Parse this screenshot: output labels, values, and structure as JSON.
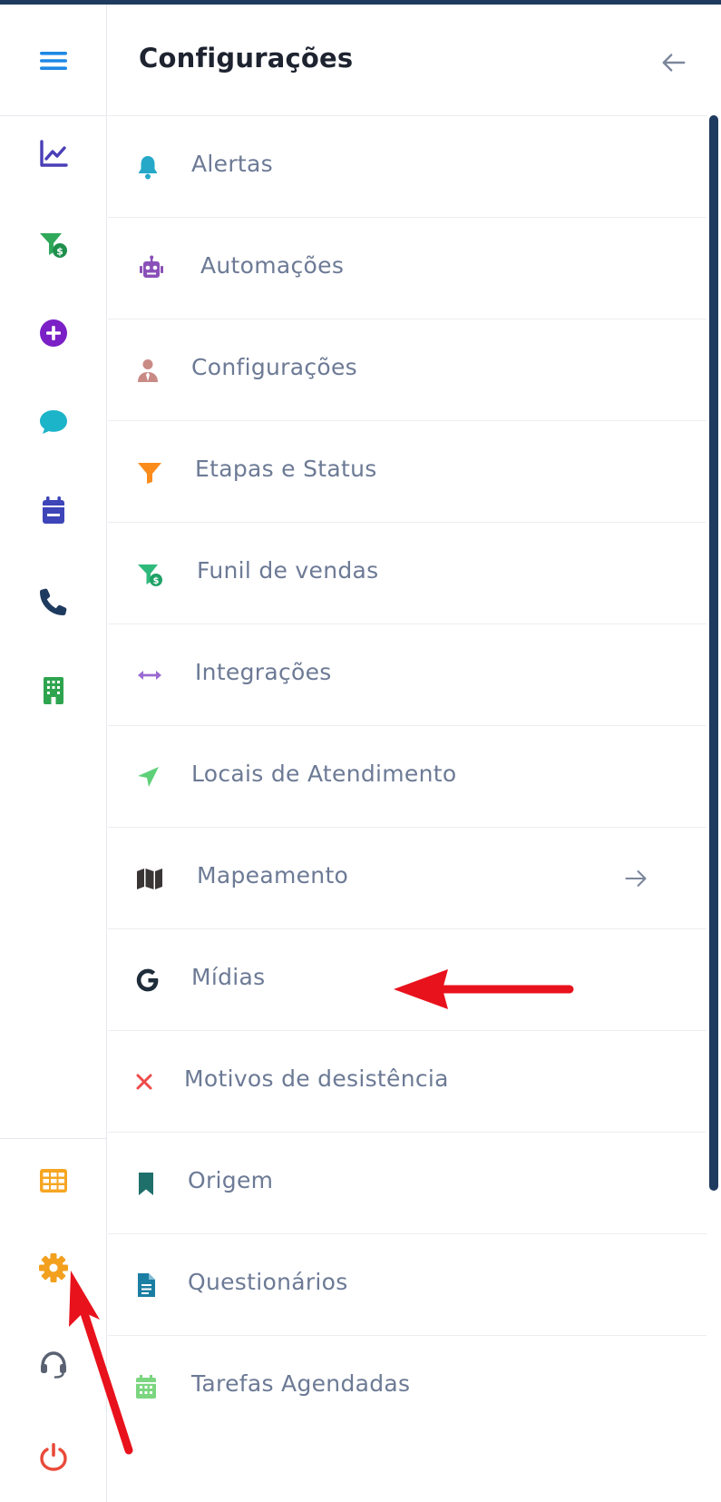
{
  "header": {
    "title": "Configurações"
  },
  "rail": {
    "icons": [
      "menu-icon",
      "chart-line-icon",
      "funnel-dollar-icon",
      "plus-circle-icon",
      "chat-bubble-icon",
      "calendar-icon",
      "phone-icon",
      "building-icon",
      "grid-table-icon",
      "gear-icon",
      "headset-icon",
      "power-icon"
    ]
  },
  "menu": {
    "items": [
      {
        "label": "Alertas",
        "icon": "bell-icon",
        "color": "#26a9c9"
      },
      {
        "label": "Automações",
        "icon": "robot-icon",
        "color": "#8a4fb8"
      },
      {
        "label": "Configurações",
        "icon": "user-tie-icon",
        "color": "#c98a86"
      },
      {
        "label": "Etapas e Status",
        "icon": "funnel-icon",
        "color": "#fb8c1c"
      },
      {
        "label": "Funil de vendas",
        "icon": "funnel-dollar-icon",
        "color": "#2fba7c"
      },
      {
        "label": "Integrações",
        "icon": "arrows-h-icon",
        "color": "#9a6ad1"
      },
      {
        "label": "Locais de Atendimento",
        "icon": "location-arrow-icon",
        "color": "#5fd07a"
      },
      {
        "label": "Mapeamento",
        "icon": "map-icon",
        "color": "#3a3535"
      },
      {
        "label": "Mídias",
        "icon": "google-icon",
        "color": "#1f2c3a"
      },
      {
        "label": "Motivos de desistência",
        "icon": "times-icon",
        "color": "#ef4a4a"
      },
      {
        "label": "Origem",
        "icon": "bookmark-icon",
        "color": "#1f6f6a"
      },
      {
        "label": "Questionários",
        "icon": "file-alt-icon",
        "color": "#1b7ea3"
      },
      {
        "label": "Tarefas Agendadas",
        "icon": "calendar-alt-icon",
        "color": "#7bd67f"
      }
    ]
  },
  "colors": {
    "accent": "#1f3a5f",
    "menu_text": "#6c7a95",
    "annotation": "#e8121c"
  }
}
